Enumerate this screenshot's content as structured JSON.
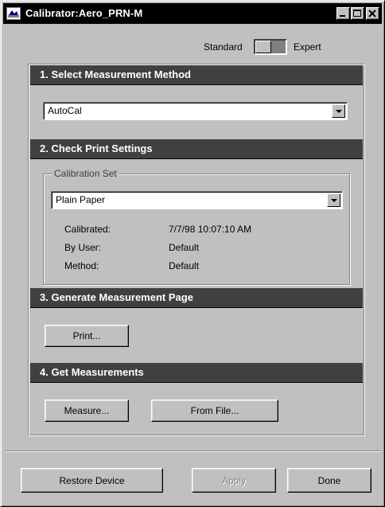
{
  "window": {
    "title": "Calibrator:Aero_PRN-M",
    "controls": [
      "minimize-icon",
      "maximize-icon",
      "close-icon"
    ]
  },
  "mode": {
    "standard_label": "Standard",
    "expert_label": "Expert",
    "selected": "Standard"
  },
  "sections": {
    "s1": {
      "header": "1. Select Measurement Method",
      "method_value": "AutoCal"
    },
    "s2": {
      "header": "2. Check Print Settings",
      "group_label": "Calibration Set",
      "calibration_set_value": "Plain Paper",
      "info": {
        "calibrated_label": "Calibrated:",
        "calibrated_value": "7/7/98 10:07:10 AM",
        "by_user_label": "By User:",
        "by_user_value": "Default",
        "method_label": "Method:",
        "method_value": "Default"
      }
    },
    "s3": {
      "header": "3. Generate Measurement Page",
      "print_button": "Print..."
    },
    "s4": {
      "header": "4. Get Measurements",
      "measure_button": "Measure...",
      "from_file_button": "From File..."
    }
  },
  "footer": {
    "restore_button": "Restore Device",
    "apply_button": "Apply",
    "done_button": "Done",
    "apply_enabled": false
  },
  "colors": {
    "face": "#c0c0c0",
    "header_bg": "#404040",
    "titlebar_bg": "#000000",
    "disabled_text": "#808080"
  }
}
